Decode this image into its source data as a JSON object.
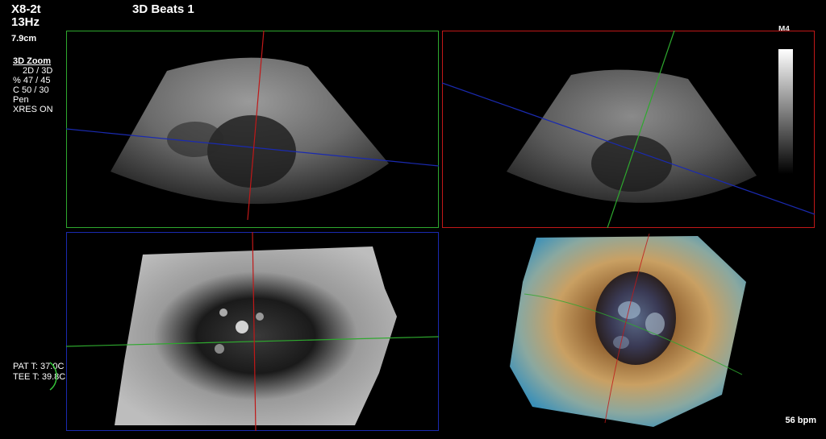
{
  "header": {
    "probe": "X8-2t",
    "frame_rate": "13Hz",
    "depth": "7.9cm",
    "title": "3D Beats 1"
  },
  "params": {
    "mode": "3D Zoom",
    "dims": "2D / 3D",
    "percent": "% 47 / 45",
    "compress": "C  50 / 30",
    "preset": "Pen",
    "xres": "XRES ON"
  },
  "temps": {
    "patient": "PAT T: 37.0C",
    "tee": "TEE T: 39.8C"
  },
  "map": {
    "label": "M4"
  },
  "heart_rate": "56 bpm",
  "colors": {
    "green": "#2ea82e",
    "red": "#c01818",
    "blue": "#1a2ab0"
  },
  "views": [
    {
      "name": "view-upper-left",
      "frame": "green"
    },
    {
      "name": "view-upper-right",
      "frame": "red"
    },
    {
      "name": "view-lower-left",
      "frame": "blue"
    },
    {
      "name": "view-3d-render",
      "frame": "none"
    }
  ]
}
